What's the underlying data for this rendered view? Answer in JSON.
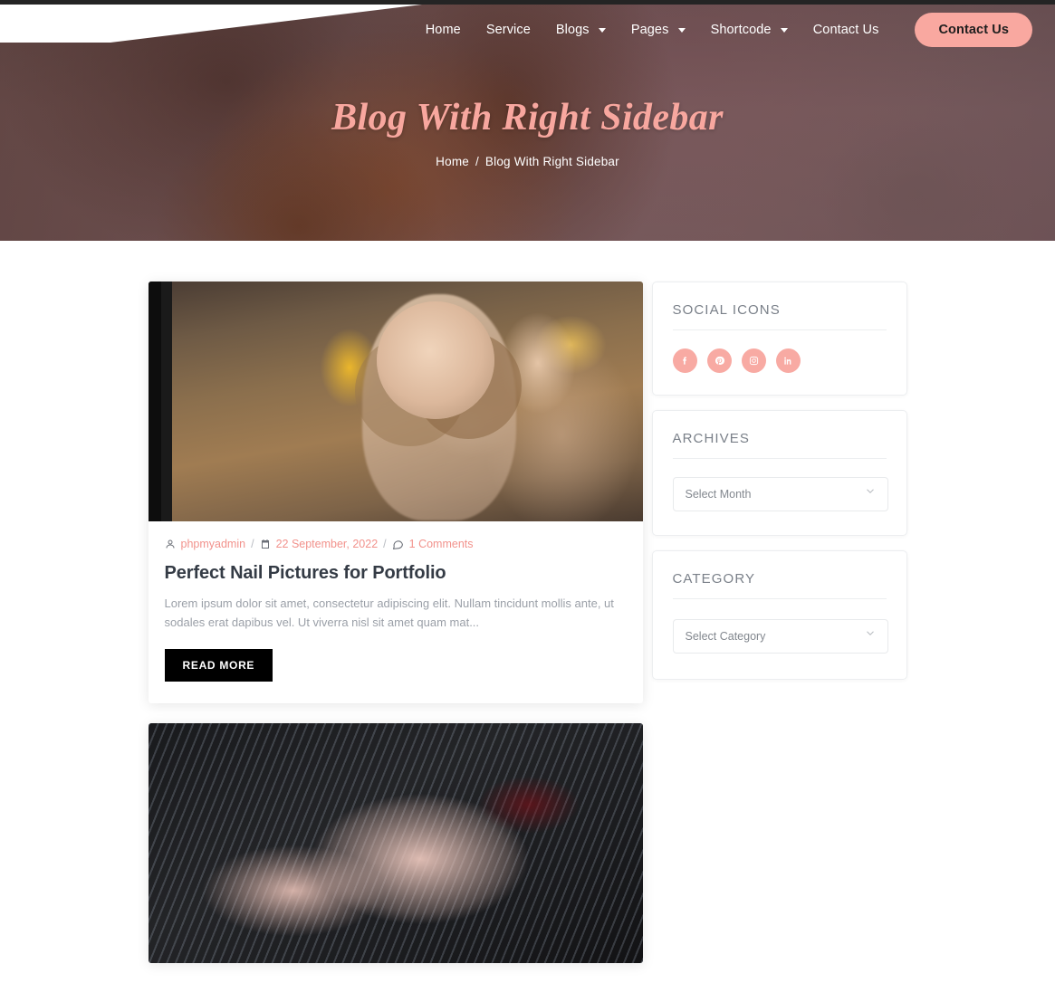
{
  "nav": {
    "items": [
      {
        "label": "Home",
        "has_dropdown": false
      },
      {
        "label": "Service",
        "has_dropdown": false
      },
      {
        "label": "Blogs",
        "has_dropdown": true
      },
      {
        "label": "Pages",
        "has_dropdown": true
      },
      {
        "label": "Shortcode",
        "has_dropdown": true
      },
      {
        "label": "Contact Us",
        "has_dropdown": false
      }
    ],
    "cta_label": "Contact Us"
  },
  "hero": {
    "title": "Blog With Right Sidebar",
    "breadcrumb": {
      "home": "Home",
      "separator": "/",
      "current": "Blog With Right Sidebar"
    }
  },
  "posts": [
    {
      "thumb_alt": "smiling-businesswoman-holding-tablet",
      "author": "phpmyadmin",
      "date": "22 September, 2022",
      "comments": "1 Comments",
      "separator": "/",
      "title": "Perfect Nail Pictures for Portfolio",
      "excerpt": "Lorem ipsum dolor sit amet, consectetur adipiscing elit. Nullam tincidunt mollis ante, ut sodales erat dapibus vel. Ut viverra nisl sit amet quam mat...",
      "read_more": "READ MORE"
    },
    {
      "thumb_alt": "feet-with-dark-red-pedicure-on-mesh-chair"
    }
  ],
  "sidebar": {
    "widgets": [
      {
        "id": "social",
        "title": "SOCIAL ICONS",
        "socials": [
          {
            "name": "facebook-icon",
            "glyph": "f"
          },
          {
            "name": "pinterest-icon",
            "glyph": "P"
          },
          {
            "name": "instagram-icon",
            "glyph": "o"
          },
          {
            "name": "linkedin-icon",
            "glyph": "in"
          }
        ]
      },
      {
        "id": "archives",
        "title": "ARCHIVES",
        "select_value": "Select Month"
      },
      {
        "id": "category",
        "title": "CATEGORY",
        "select_value": "Select Category"
      }
    ]
  },
  "colors": {
    "accent_pink": "#f9a8a0",
    "meta_pink": "#f2928c",
    "title_dark": "#343b45",
    "muted_gray": "#9ba0a8",
    "widget_title": "#7a8089",
    "button_black": "#000000"
  }
}
